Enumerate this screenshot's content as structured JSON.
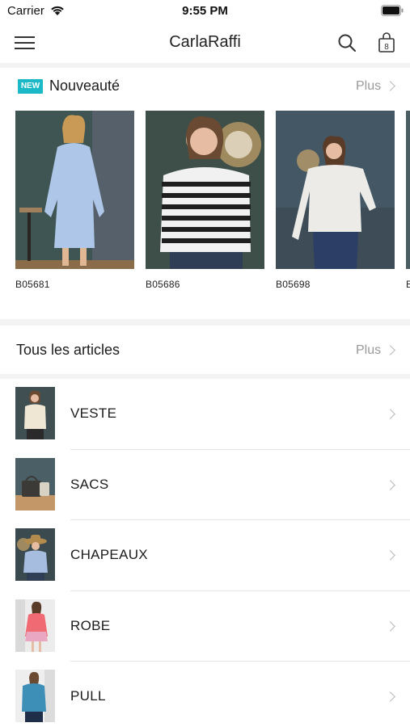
{
  "status_bar": {
    "carrier": "Carrier",
    "time": "9:55 PM"
  },
  "nav": {
    "title": "CarlaRaffi",
    "cart_count": "8"
  },
  "new_section": {
    "badge": "NEW",
    "title": "Nouveauté",
    "more": "Plus",
    "products": [
      {
        "sku": "B05681"
      },
      {
        "sku": "B05686"
      },
      {
        "sku": "B05698"
      },
      {
        "sku": "B"
      }
    ]
  },
  "all_section": {
    "title": "Tous les articles",
    "more": "Plus",
    "categories": [
      {
        "label": "VESTE"
      },
      {
        "label": "SACS"
      },
      {
        "label": "CHAPEAUX"
      },
      {
        "label": "ROBE"
      },
      {
        "label": "PULL"
      }
    ]
  },
  "colors": {
    "accent": "#1bb9c8",
    "muted": "#9a9a9a",
    "background_gap": "#f3f3f3"
  },
  "icons": [
    "wifi-icon",
    "battery-icon",
    "hamburger-menu-icon",
    "search-icon",
    "shopping-bag-icon",
    "chevron-right-icon"
  ]
}
